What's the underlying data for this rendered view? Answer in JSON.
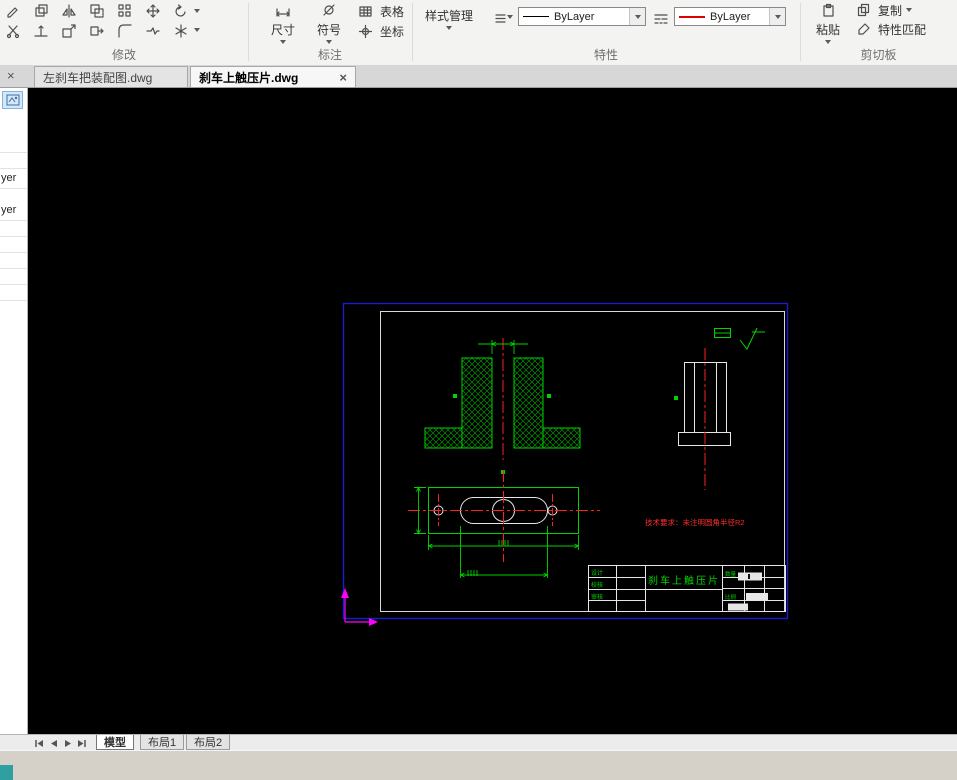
{
  "ribbon": {
    "modify": {
      "label": "修改"
    },
    "annotate": {
      "label": "标注",
      "dimension": "尺寸",
      "symbol": "符号",
      "table": "表格",
      "coordinate": "坐标"
    },
    "properties": {
      "label": "特性",
      "style_manager": "样式管理",
      "layer_value": "ByLayer",
      "color_value": "ByLayer"
    },
    "clipboard": {
      "label": "剪切板",
      "paste": "粘贴",
      "copy": "复制",
      "match": "特性匹配"
    }
  },
  "tabs": {
    "close_all_glyph": "×",
    "items": [
      {
        "label": "左刹车把装配图.dwg",
        "active": false
      },
      {
        "label": "刹车上触压片.dwg",
        "active": true,
        "close_glyph": "×"
      }
    ]
  },
  "sidebar": {
    "clipped": [
      "yer",
      "yer"
    ]
  },
  "drawing": {
    "note": "技术要求：未注明圆角半径R2",
    "title_block": {
      "title": "刹车上触压片",
      "rows_left": [
        "设计",
        "校核",
        "审核"
      ],
      "labels_right": [
        "数量",
        "比例"
      ]
    }
  },
  "layout_tabs": [
    {
      "label": "模型",
      "active": true
    },
    {
      "label": "布局1",
      "active": false
    },
    {
      "label": "布局2",
      "active": false
    }
  ],
  "colors": {
    "entity_green": "#00d400",
    "centerline_red": "#ff2020",
    "frame_blue": "#1b1bd0",
    "ucs_magenta": "#ff00ff"
  }
}
